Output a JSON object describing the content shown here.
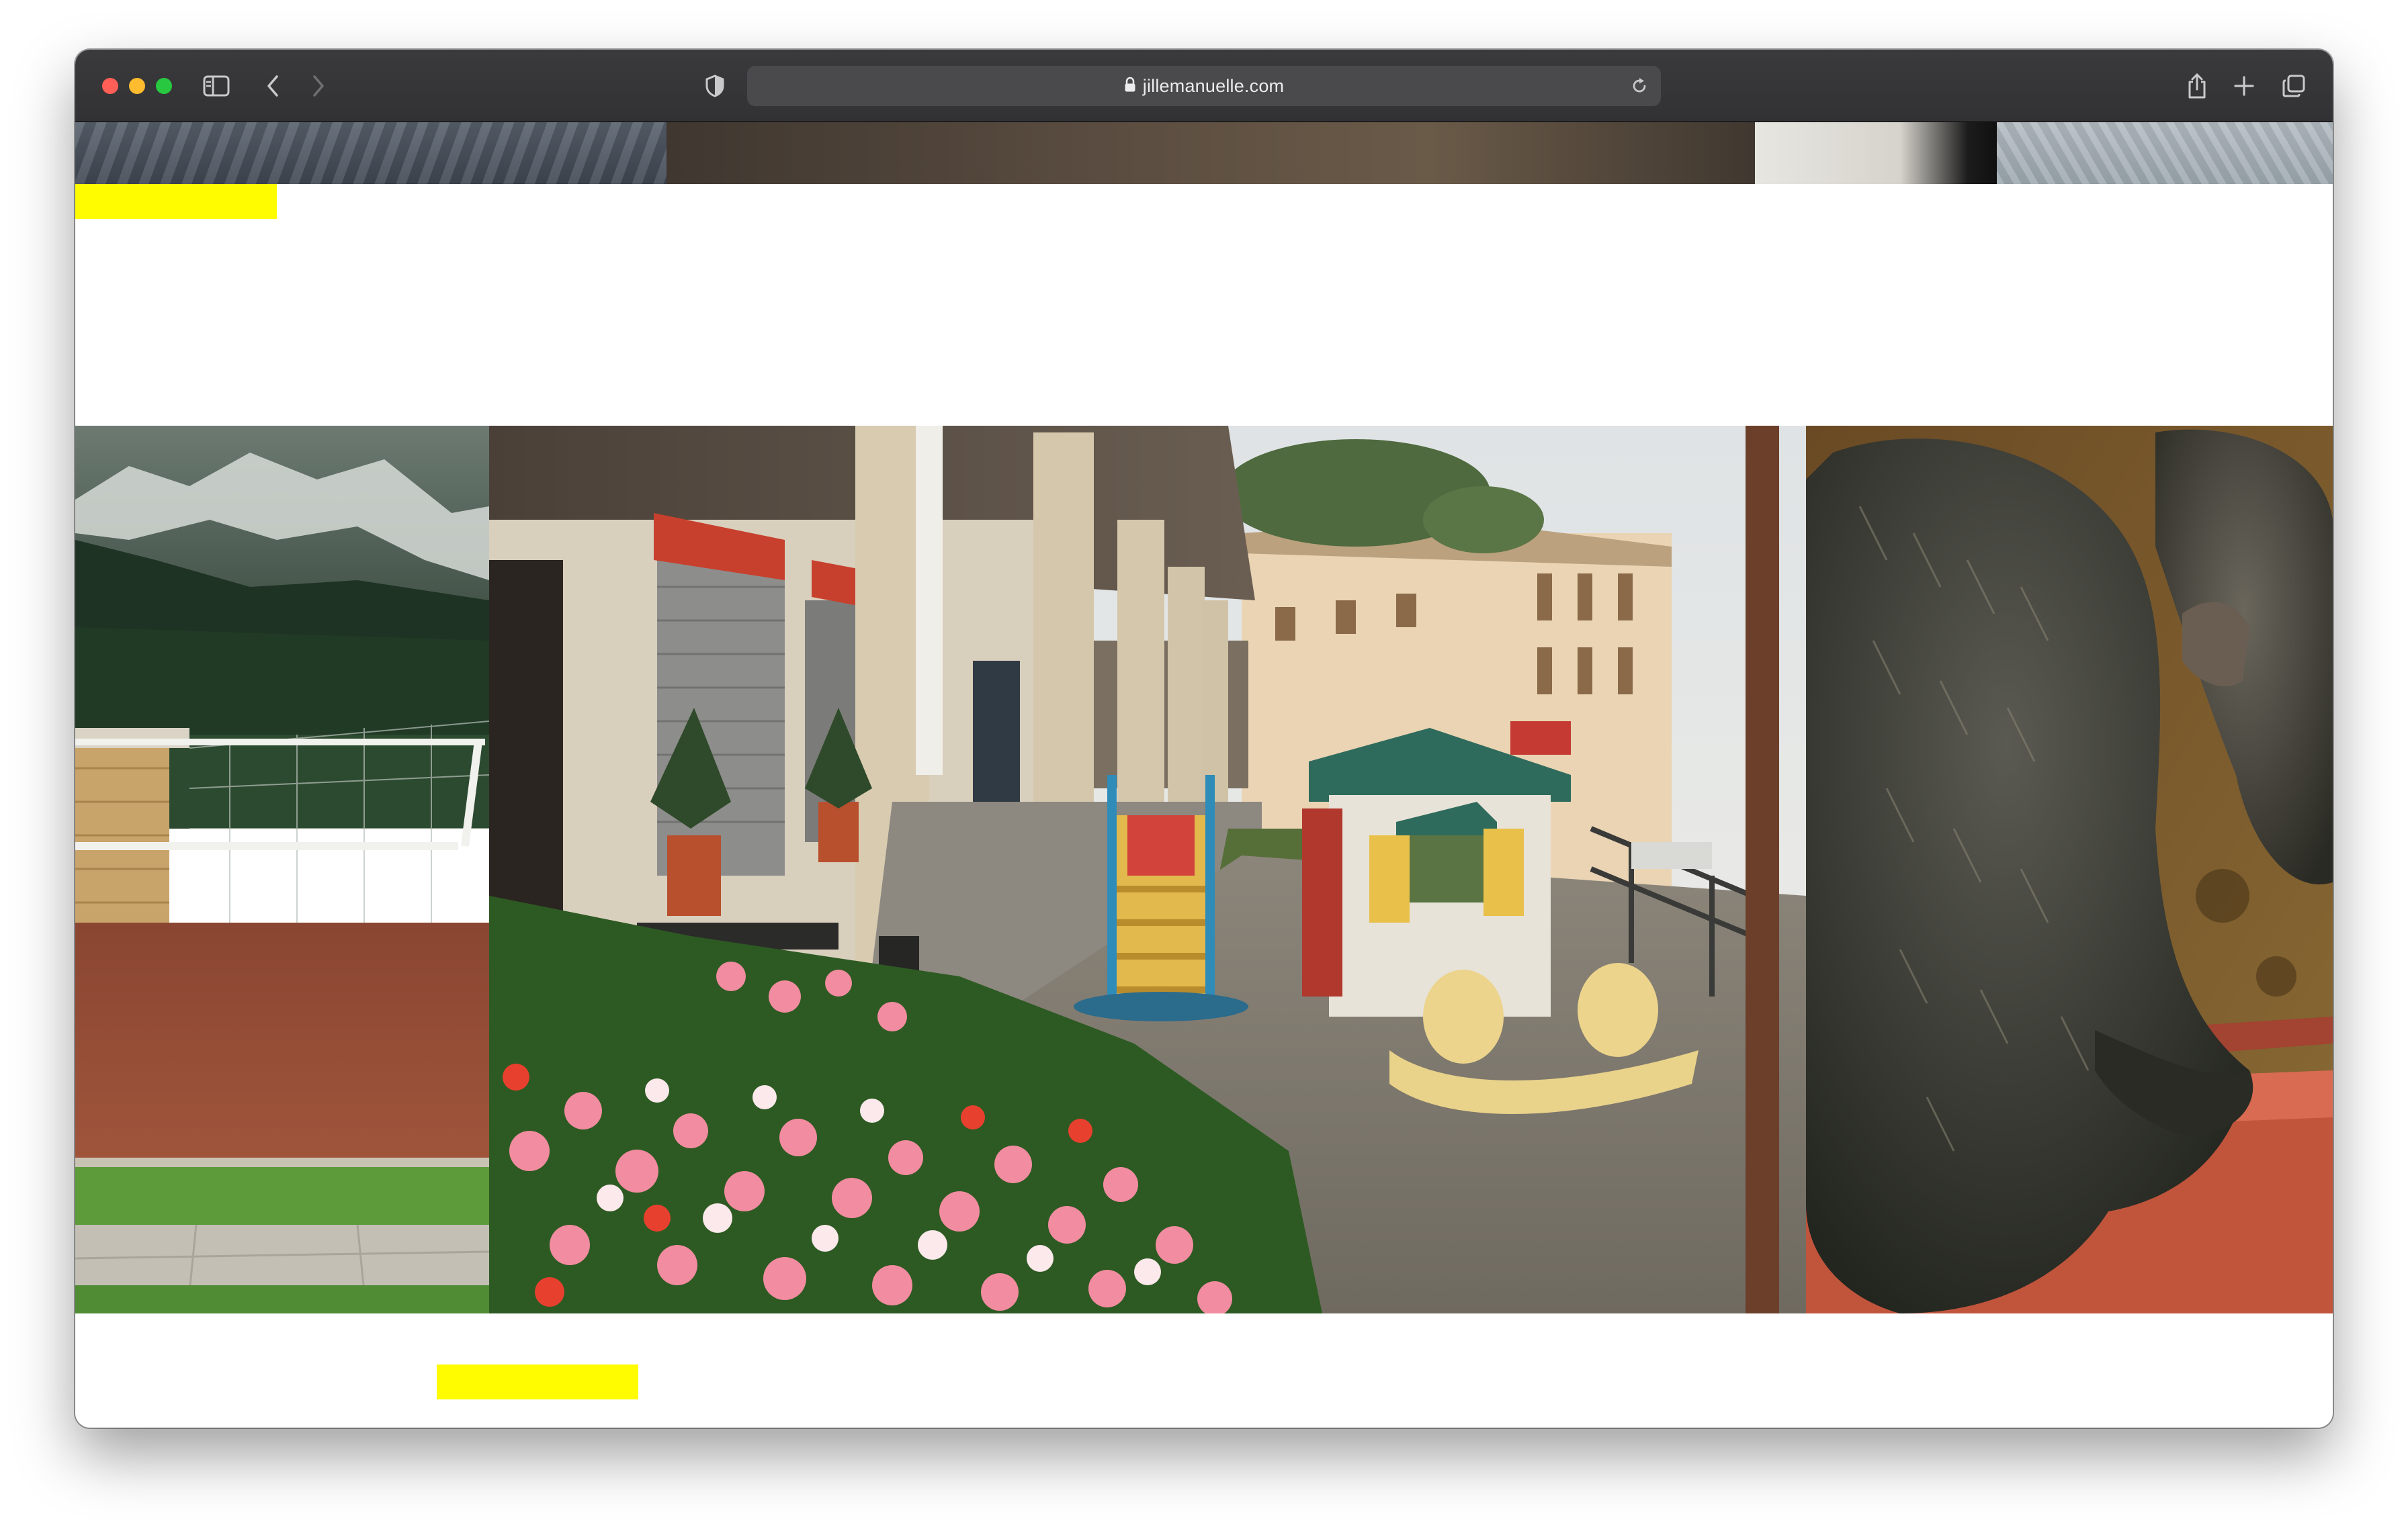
{
  "browser": {
    "url": "jillemanuelle.com",
    "icons": {
      "sidebar": "sidebar-toggle-icon",
      "back": "back-chevron-icon",
      "forward": "forward-chevron-icon",
      "privacy": "shield-icon",
      "lock": "lock-icon",
      "reload": "reload-icon",
      "share": "share-icon",
      "new_tab": "plus-icon",
      "tabs": "tab-overview-icon"
    }
  },
  "page": {
    "accent_color": "#fffc00",
    "photos": [
      {
        "subject": "sports court with volleyball net in front of forested mountain"
      },
      {
        "subject": "arcade with flowers, plastic slide and toy playhouse"
      },
      {
        "subject": "shaggy dark pigs eating from a trough"
      }
    ]
  }
}
